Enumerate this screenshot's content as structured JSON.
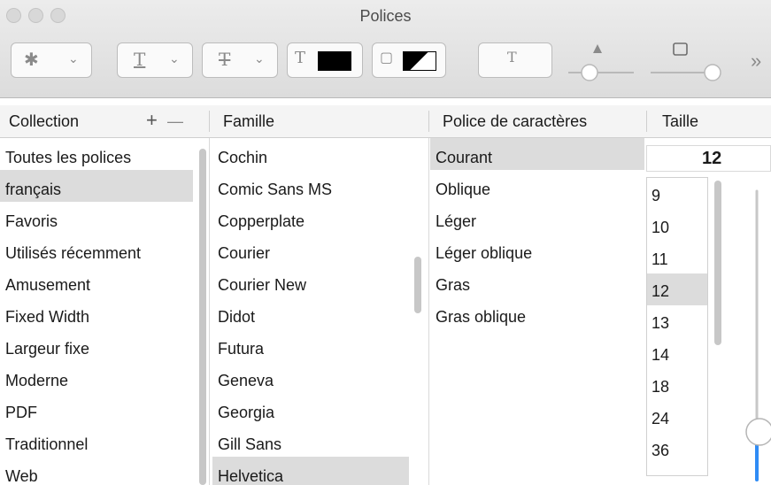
{
  "window": {
    "title": "Polices"
  },
  "toolbar": {
    "more_label": "»"
  },
  "header": {
    "collection": "Collection",
    "add": "+",
    "remove": "—",
    "family": "Famille",
    "typeface": "Police de caractères",
    "size": "Taille"
  },
  "collections": [
    "Toutes les polices",
    "français",
    "Favoris",
    "Utilisés récemment",
    "Amusement",
    "Fixed Width",
    "Largeur fixe",
    "Moderne",
    "PDF",
    "Traditionnel",
    "Web"
  ],
  "families": [
    "Cochin",
    "Comic Sans MS",
    "Copperplate",
    "Courier",
    "Courier New",
    "Didot",
    "Futura",
    "Geneva",
    "Georgia",
    "Gill Sans",
    "Helvetica"
  ],
  "typefaces": [
    "Courant",
    "Oblique",
    "Léger",
    "Léger oblique",
    "Gras",
    "Gras oblique"
  ],
  "size": {
    "value": "12",
    "options": [
      "9",
      "10",
      "11",
      "12",
      "13",
      "14",
      "18",
      "24",
      "36"
    ]
  },
  "colors": {
    "selection": "#dcdcdc",
    "slider_active": "#2f8cf5"
  }
}
